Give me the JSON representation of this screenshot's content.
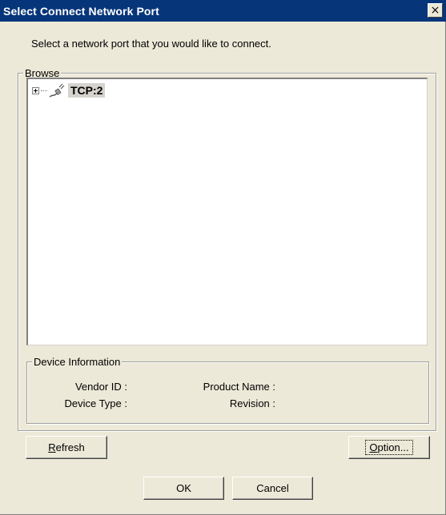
{
  "window": {
    "title": "Select Connect Network Port",
    "close_glyph": "×"
  },
  "instruction": "Select a network port that you would like to connect.",
  "browse": {
    "label": "Browse",
    "tree": [
      {
        "label": "TCP:2",
        "icon": "network-port-icon",
        "expanded": false,
        "selected": true
      }
    ]
  },
  "device_info": {
    "label": "Device Information",
    "vendor_id_label": "Vendor ID :",
    "device_type_label": "Device Type :",
    "product_name_label": "Product Name :",
    "revision_label": "Revision :"
  },
  "buttons": {
    "refresh_first": "R",
    "refresh_rest": "efresh",
    "option_first": "O",
    "option_rest": "ption...",
    "ok": "OK",
    "cancel": "Cancel"
  },
  "colors": {
    "titlebar": "#06357a",
    "dialog_bg": "#ece9d8"
  }
}
